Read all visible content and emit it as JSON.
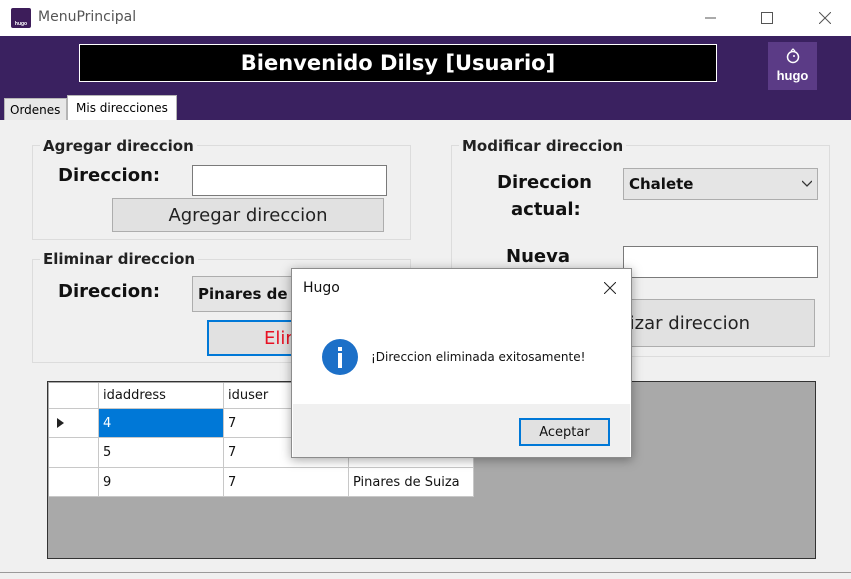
{
  "window": {
    "title": "MenuPrincipal",
    "icon": "hugo-app-icon"
  },
  "header": {
    "welcome": "Bienvenido Dilsy [Usuario]",
    "logo_text": "hugo",
    "logo_icon": "bird-icon",
    "bg_color": "#3a2160"
  },
  "tabs": [
    {
      "label": "Ordenes"
    },
    {
      "label": "Mis direcciones"
    }
  ],
  "add_group": {
    "title": "Agregar direccion",
    "label": "Direccion:",
    "input_value": "",
    "button": "Agregar direccion"
  },
  "delete_group": {
    "title": "Eliminar direccion",
    "label": "Direccion:",
    "combo_value": "Pinares de S",
    "button": "Elim"
  },
  "modify_group": {
    "title": "Modificar direccion",
    "current_label_1": "Direccion",
    "current_label_2": "actual:",
    "current_value": "Chalete",
    "new_label": "Nueva",
    "new_value": "",
    "button": "lizar direccion"
  },
  "grid": {
    "columns": [
      "idaddress",
      "iduser"
    ],
    "rows": [
      {
        "idaddress": "4",
        "iduser": "7",
        "third": "",
        "selected": true
      },
      {
        "idaddress": "5",
        "iduser": "7",
        "third": ""
      },
      {
        "idaddress": "9",
        "iduser": "7",
        "third": "Pinares de Suiza"
      }
    ]
  },
  "dialog": {
    "title": "Hugo",
    "message": "¡Direccion eliminada exitosamente!",
    "ok_label": "Aceptar",
    "icon": "info-icon"
  },
  "colors": {
    "accent": "#0078d7",
    "danger_text": "#e81123",
    "selection": "#0078d7"
  }
}
